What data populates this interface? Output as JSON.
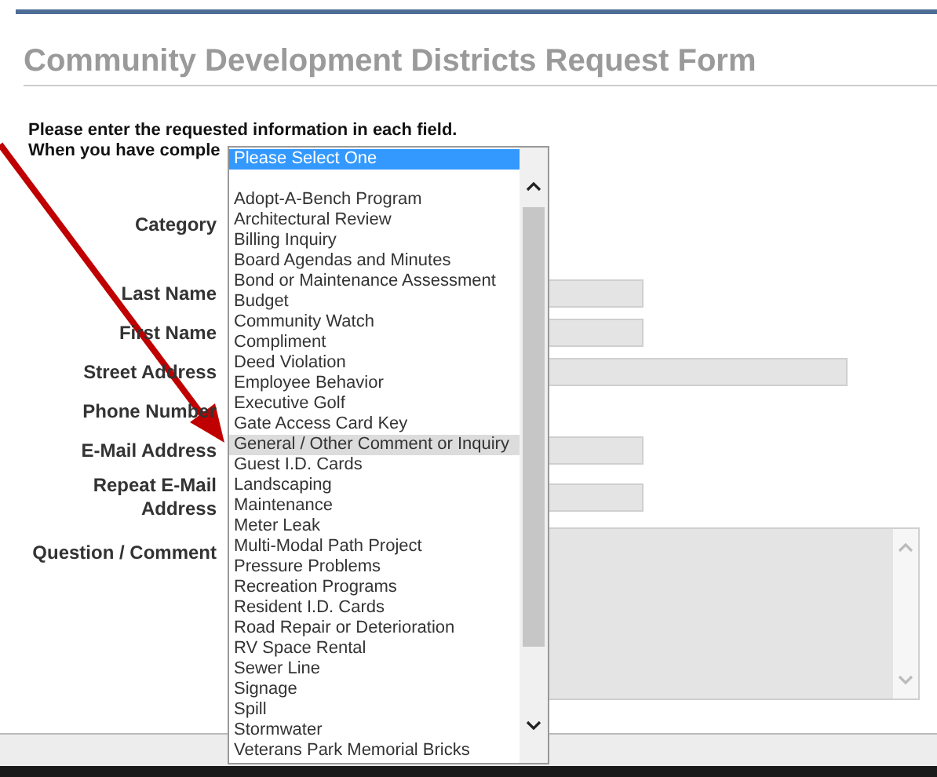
{
  "title": "Community Development Districts Request Form",
  "intro": [
    "Please enter the requested information in each field.",
    "When you have comple"
  ],
  "fields": [
    {
      "label": "Category",
      "kind": "select"
    },
    {
      "label": "Last Name",
      "kind": "short"
    },
    {
      "label": "First Name",
      "kind": "short"
    },
    {
      "label": "Street Address",
      "kind": "long"
    },
    {
      "label": "Phone Number",
      "kind": "none"
    },
    {
      "label": "E-Mail Address",
      "kind": "short"
    },
    {
      "label": "Repeat E-Mail Address",
      "kind": "short"
    },
    {
      "label": "Question / Comment",
      "kind": "textarea"
    }
  ],
  "dropdown": {
    "options": [
      {
        "label": "Please Select One",
        "kind": "placeholder",
        "selected": true,
        "hovered": false
      },
      {
        "label": "Adopt-A-Bench Program",
        "kind": "option",
        "selected": false,
        "hovered": false
      },
      {
        "label": "Architectural Review",
        "kind": "option",
        "selected": false,
        "hovered": false
      },
      {
        "label": "Billing Inquiry",
        "kind": "option",
        "selected": false,
        "hovered": false
      },
      {
        "label": "Board Agendas and Minutes",
        "kind": "option",
        "selected": false,
        "hovered": false
      },
      {
        "label": "Bond or Maintenance Assessment",
        "kind": "option",
        "selected": false,
        "hovered": false
      },
      {
        "label": "Budget",
        "kind": "option",
        "selected": false,
        "hovered": false
      },
      {
        "label": "Community Watch",
        "kind": "option",
        "selected": false,
        "hovered": false
      },
      {
        "label": "Compliment",
        "kind": "option",
        "selected": false,
        "hovered": false
      },
      {
        "label": "Deed Violation",
        "kind": "option",
        "selected": false,
        "hovered": false
      },
      {
        "label": "Employee Behavior",
        "kind": "option",
        "selected": false,
        "hovered": false
      },
      {
        "label": "Executive Golf",
        "kind": "option",
        "selected": false,
        "hovered": false
      },
      {
        "label": "Gate Access Card Key",
        "kind": "option",
        "selected": false,
        "hovered": false
      },
      {
        "label": "General / Other Comment or Inquiry",
        "kind": "option",
        "selected": false,
        "hovered": true
      },
      {
        "label": "Guest I.D. Cards",
        "kind": "option",
        "selected": false,
        "hovered": false
      },
      {
        "label": "Landscaping",
        "kind": "option",
        "selected": false,
        "hovered": false
      },
      {
        "label": "Maintenance",
        "kind": "option",
        "selected": false,
        "hovered": false
      },
      {
        "label": "Meter Leak",
        "kind": "option",
        "selected": false,
        "hovered": false
      },
      {
        "label": "Multi-Modal Path Project",
        "kind": "option",
        "selected": false,
        "hovered": false
      },
      {
        "label": "Pressure Problems",
        "kind": "option",
        "selected": false,
        "hovered": false
      },
      {
        "label": "Recreation Programs",
        "kind": "option",
        "selected": false,
        "hovered": false
      },
      {
        "label": "Resident I.D. Cards",
        "kind": "option",
        "selected": false,
        "hovered": false
      },
      {
        "label": "Road Repair or Deterioration",
        "kind": "option",
        "selected": false,
        "hovered": false
      },
      {
        "label": "RV Space Rental",
        "kind": "option",
        "selected": false,
        "hovered": false
      },
      {
        "label": "Sewer Line",
        "kind": "option",
        "selected": false,
        "hovered": false
      },
      {
        "label": "Signage",
        "kind": "option",
        "selected": false,
        "hovered": false
      },
      {
        "label": "Spill",
        "kind": "option",
        "selected": false,
        "hovered": false
      },
      {
        "label": "Stormwater",
        "kind": "option",
        "selected": false,
        "hovered": false
      },
      {
        "label": "Veterans Park Memorial Bricks",
        "kind": "option",
        "selected": false,
        "hovered": false
      }
    ]
  }
}
